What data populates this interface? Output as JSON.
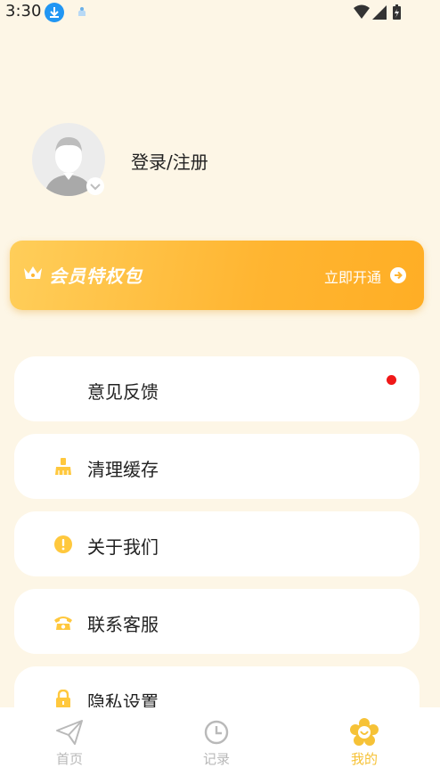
{
  "status": {
    "time": "3:30"
  },
  "profile": {
    "login_label": "登录/注册"
  },
  "vip": {
    "title": "会员特权包",
    "cta": "立即开通"
  },
  "menu": [
    {
      "label": "意见反馈",
      "icon": "chat-icon"
    },
    {
      "label": "清理缓存",
      "icon": "broom-icon"
    },
    {
      "label": "关于我们",
      "icon": "info-icon"
    },
    {
      "label": "联系客服",
      "icon": "phone-icon"
    },
    {
      "label": "隐私设置",
      "icon": "lock-icon"
    }
  ],
  "tabs": [
    {
      "label": "首页",
      "icon": "paper-plane-icon"
    },
    {
      "label": "记录",
      "icon": "clock-icon"
    },
    {
      "label": "我的",
      "icon": "flower-face-icon",
      "active": true
    }
  ],
  "colors": {
    "background": "#FDF6E6",
    "accent": "#FFB531",
    "icon_yellow": "#FFC83D",
    "tab_inactive": "#B9B9B9",
    "tab_active": "#F6C237",
    "notify_dot": "#F01818"
  }
}
